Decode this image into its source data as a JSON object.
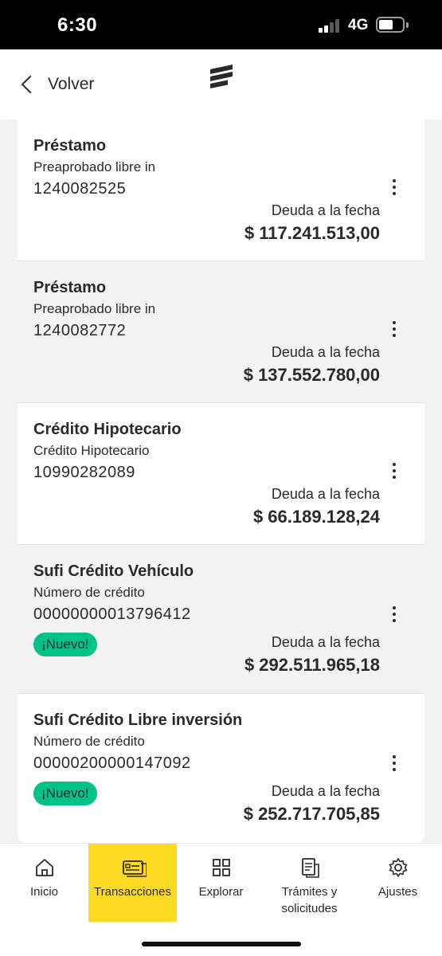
{
  "status_bar": {
    "time": "6:30",
    "network": "4G",
    "signal_icon": "signal-bars-icon",
    "battery_icon": "battery-icon"
  },
  "header": {
    "back_label": "Volver",
    "back_icon": "chevron-left-icon",
    "logo_icon": "bancolombia-logo-icon"
  },
  "colors": {
    "accent_yellow": "#fdda24",
    "badge_green": "#00c389",
    "text": "#2c2a29"
  },
  "products": [
    {
      "title": "Préstamo",
      "subtitle": "Preaprobado libre in",
      "number": "1240082525",
      "debt_label": "Deuda a la fecha",
      "amount": "$ 117.241.513,00",
      "badge": ""
    },
    {
      "title": "Préstamo",
      "subtitle": "Preaprobado libre in",
      "number": "1240082772",
      "debt_label": "Deuda a la fecha",
      "amount": "$ 137.552.780,00",
      "badge": ""
    },
    {
      "title": "Crédito Hipotecario",
      "subtitle": "Crédito Hipotecario",
      "number": "10990282089",
      "debt_label": "Deuda a la fecha",
      "amount": "$ 66.189.128,24",
      "badge": ""
    },
    {
      "title": "Sufi Crédito Vehículo",
      "subtitle": "Número de crédito",
      "number": "00000000013796412",
      "debt_label": "Deuda a la fecha",
      "amount": "$ 292.511.965,18",
      "badge": "¡Nuevo!"
    },
    {
      "title": "Sufi Crédito Libre inversión",
      "subtitle": "Número de crédito",
      "number": "00000200000147092",
      "debt_label": "Deuda a la fecha",
      "amount": "$ 252.717.705,85",
      "badge": "¡Nuevo!"
    }
  ],
  "bottom_nav": {
    "items": [
      {
        "label": "Inicio",
        "icon": "home-icon",
        "active": false
      },
      {
        "label": "Transacciones",
        "icon": "transactions-card-icon",
        "active": true
      },
      {
        "label": "Explorar",
        "icon": "grid-icon",
        "active": false
      },
      {
        "label": "Trámites y solicitudes",
        "icon": "documents-icon",
        "active": false
      },
      {
        "label": "Ajustes",
        "icon": "gear-icon",
        "active": false
      }
    ]
  }
}
